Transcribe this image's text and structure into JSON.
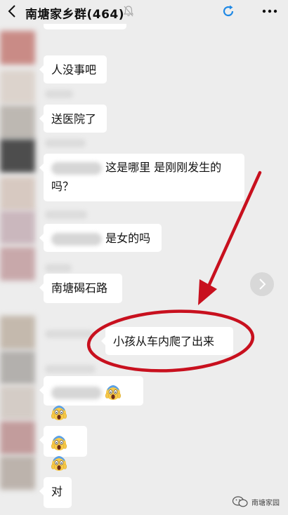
{
  "header": {
    "title": "南塘家乡群(464)",
    "icons": [
      "back-icon",
      "mute-icon",
      "refresh-icon",
      "more-icon"
    ]
  },
  "messages": [
    {
      "text": "人没事吧"
    },
    {
      "text": "送医院了"
    },
    {
      "line1": "这是哪里 是刚刚发生的",
      "line2": "吗？"
    },
    {
      "text": "是女的吗"
    },
    {
      "text": "南塘碣石路"
    },
    {
      "text": "小孩从车内爬了出来"
    },
    {
      "emoji": "screaming-face"
    },
    {
      "emoji": "screaming-face"
    },
    {
      "text": "对"
    }
  ],
  "watermark": {
    "text": "南塘家园"
  },
  "colors": {
    "background": "#ededed",
    "bubble": "#ffffff",
    "annotation": "#c8101e",
    "refresh": "#1e88e5"
  }
}
